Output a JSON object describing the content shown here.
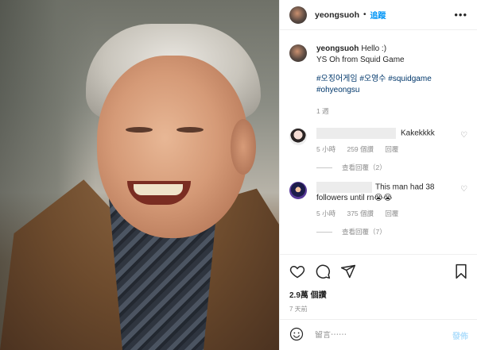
{
  "header": {
    "username": "yeongsuoh",
    "separator": "•",
    "follow_label": "追蹤",
    "more_label": "•••"
  },
  "caption": {
    "username": "yeongsuoh",
    "text_line1": "Hello :)",
    "text_line2": "YS Oh from Squid Game",
    "hashtags_line1": "#오징어게임 #오영수 #squidgame",
    "hashtags_line2": "#ohyeongsu",
    "time": "1 週"
  },
  "comments": [
    {
      "text": "Kakekkkk",
      "time": "5 小時",
      "likes": "259 個讚",
      "reply_label": "回覆",
      "view_replies": "查看回覆（2）"
    },
    {
      "text": "This man had 38 followers until rn😭😭",
      "time": "5 小時",
      "likes": "375 個讚",
      "reply_label": "回覆",
      "view_replies": "查看回覆（7）"
    }
  ],
  "stats": {
    "likes": "2.9萬 個讚",
    "date": "7 天前"
  },
  "add_comment": {
    "placeholder": "留言⋯⋯",
    "post_label": "發佈"
  },
  "icons": {
    "more": "more-options-icon",
    "heart": "heart-icon",
    "comment": "comment-icon",
    "share": "share-icon",
    "save": "bookmark-icon",
    "emoji": "emoji-icon"
  },
  "colors": {
    "accent": "#0095f6",
    "hashtag": "#00376b",
    "muted": "#8e8e8e",
    "post_disabled": "#b2dffc"
  }
}
